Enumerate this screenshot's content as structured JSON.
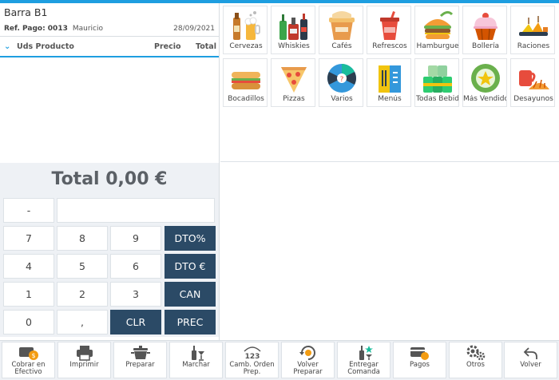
{
  "ticket": {
    "title": "Barra B1",
    "ref": "Ref. Pago: 0013",
    "user": "Mauricio",
    "date": "28/09/2021"
  },
  "columns": {
    "units_product": "Uds Producto",
    "price": "Precio",
    "total": "Total"
  },
  "total_label": "Total 0,00 €",
  "keypad": {
    "minus": "-",
    "k7": "7",
    "k8": "8",
    "k9": "9",
    "dto_pct": "DTO%",
    "k4": "4",
    "k5": "5",
    "k6": "6",
    "dto_eur": "DTO €",
    "k1": "1",
    "k2": "2",
    "k3": "3",
    "can": "CAN",
    "k0": "0",
    "comma": ",",
    "clr": "CLR",
    "prec": "PREC"
  },
  "categories": [
    {
      "label": "Cervezas",
      "icon": "beer-icon"
    },
    {
      "label": "Whiskies",
      "icon": "whisky-bottles-icon"
    },
    {
      "label": "Cafés",
      "icon": "coffee-cup-icon"
    },
    {
      "label": "Refrescos",
      "icon": "soda-cup-icon"
    },
    {
      "label": "Hamburgue",
      "icon": "hamburger-icon"
    },
    {
      "label": "Bollería",
      "icon": "cupcake-icon"
    },
    {
      "label": "Raciones",
      "icon": "cheese-plate-icon"
    },
    {
      "label": "Bocadillos",
      "icon": "sandwich-icon"
    },
    {
      "label": "Pizzas",
      "icon": "pizza-icon"
    },
    {
      "label": "Varios",
      "icon": "wheel-icon"
    },
    {
      "label": "Menús",
      "icon": "menu-icon"
    },
    {
      "label": "Todas Bebid",
      "icon": "cans-icon"
    },
    {
      "label": "Más Vendido",
      "icon": "star-badge-icon"
    },
    {
      "label": "Desayunos",
      "icon": "breakfast-icon"
    }
  ],
  "bottom": {
    "cobrar": "Cobrar en\nEfectivo",
    "imprimir": "Imprimir",
    "preparar": "Preparar",
    "marchar": "Marchar",
    "camb_orden": "Camb. Orden\nPrep.",
    "volver_preparar": "Volver\nPreparar",
    "entregar": "Entregar\nComanda",
    "pagos": "Pagos",
    "otros": "Otros",
    "volver": "Volver"
  },
  "colors": {
    "accent": "#1e9ee0",
    "dark_key": "#2b4a66",
    "panel_bg": "#eef1f5"
  }
}
